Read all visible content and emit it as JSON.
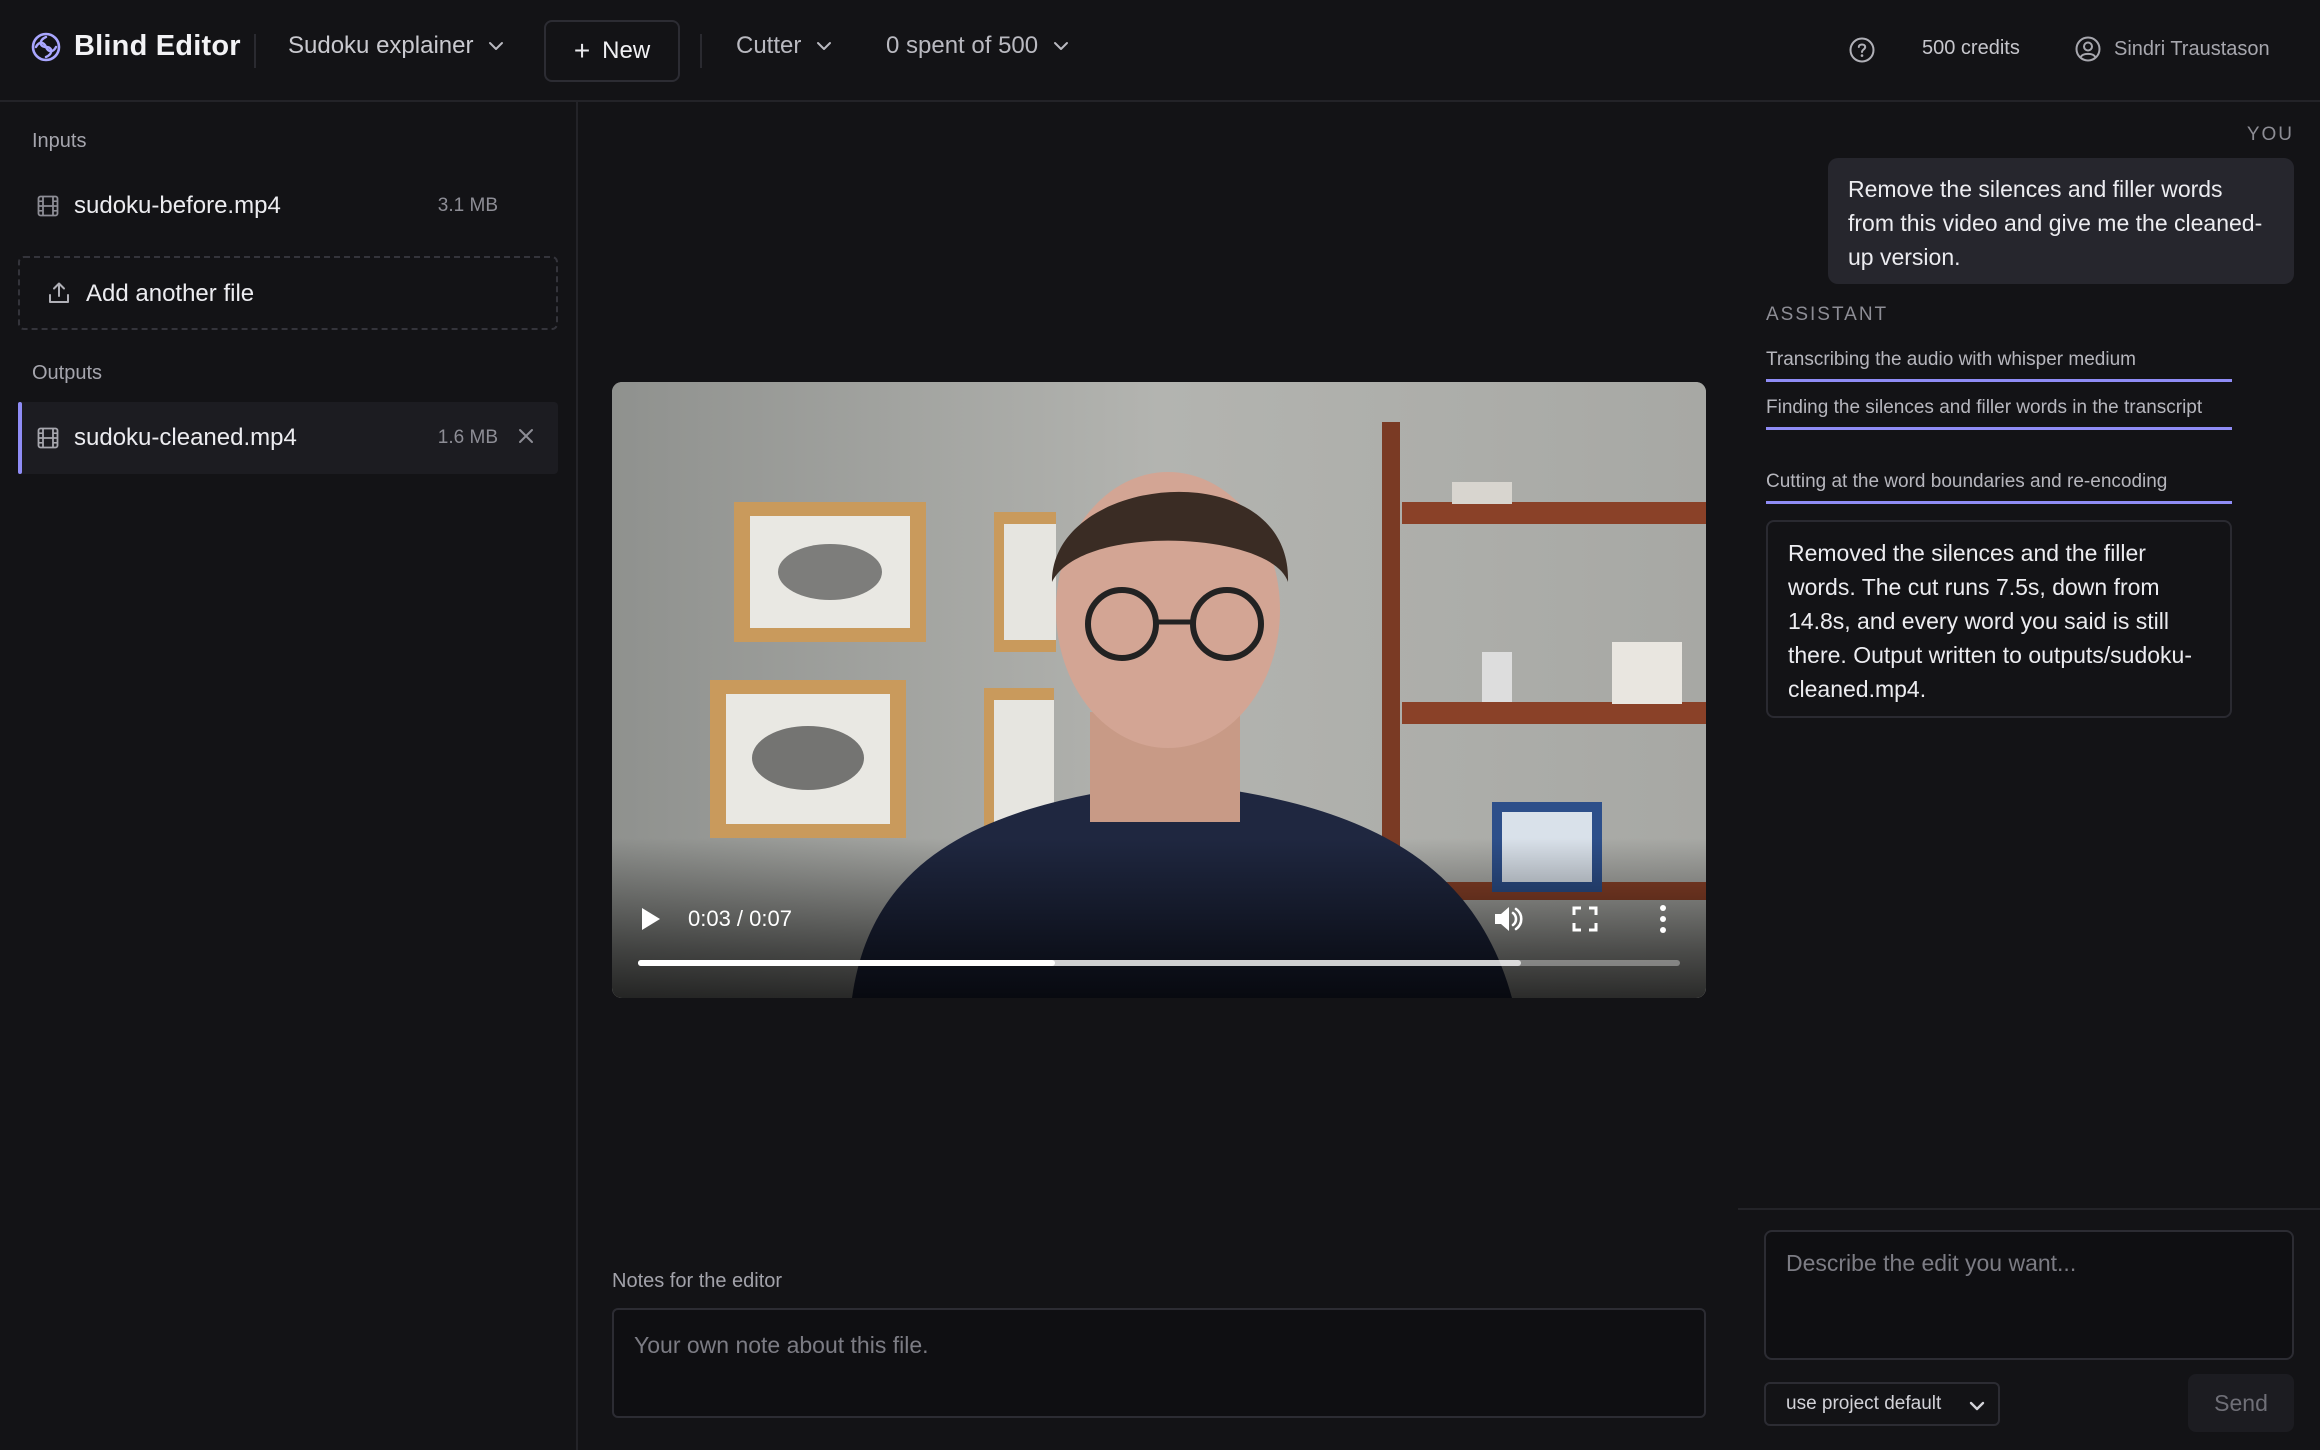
{
  "app": {
    "name": "Blind Editor",
    "logo_icon": "swirl-logo-icon"
  },
  "header": {
    "project": "Sudoku explainer",
    "new_label": "New",
    "tool": "Cutter",
    "spent": "0 spent of 500",
    "credits": "500 credits",
    "user_name": "Sindri Traustason",
    "icons": [
      "help-circle-icon",
      "user-circle-icon",
      "chevron-down-icon",
      "plus-icon"
    ]
  },
  "sidebar": {
    "inputs_label": "Inputs",
    "inputs": [
      {
        "name": "sudoku-before.mp4",
        "size": "3.1 MB",
        "icon": "film-icon"
      }
    ],
    "add_file_label": "Add another file",
    "outputs_label": "Outputs",
    "outputs": [
      {
        "name": "sudoku-cleaned.mp4",
        "size": "1.6 MB",
        "icon": "film-icon",
        "selected": true
      }
    ]
  },
  "player": {
    "time": "0:03 / 0:07",
    "played_fraction": 0.4,
    "buffered_fraction": 0.847,
    "accent": "#ffffff"
  },
  "notes": {
    "label": "Notes for the editor",
    "placeholder": "Your own note about this file."
  },
  "chat": {
    "you_label": "YOU",
    "user_message": "Remove the silences and filler words from this video and give me the cleaned-up version.",
    "assistant_label": "ASSISTANT",
    "steps": [
      "Transcribing the audio with whisper medium",
      "Finding the silences and filler words in the transcript",
      "Cutting at the word boundaries and re-encoding"
    ],
    "assistant_message": "Removed the silences and the filler words. The cut runs 7.5s, down from 14.8s, and every word you said is still there. Output written to outputs/sudoku-cleaned.mp4.",
    "input_placeholder": "Describe the edit you want...",
    "model_option": "use project default",
    "send_label": "Send",
    "accent": "#8f8cf5"
  }
}
